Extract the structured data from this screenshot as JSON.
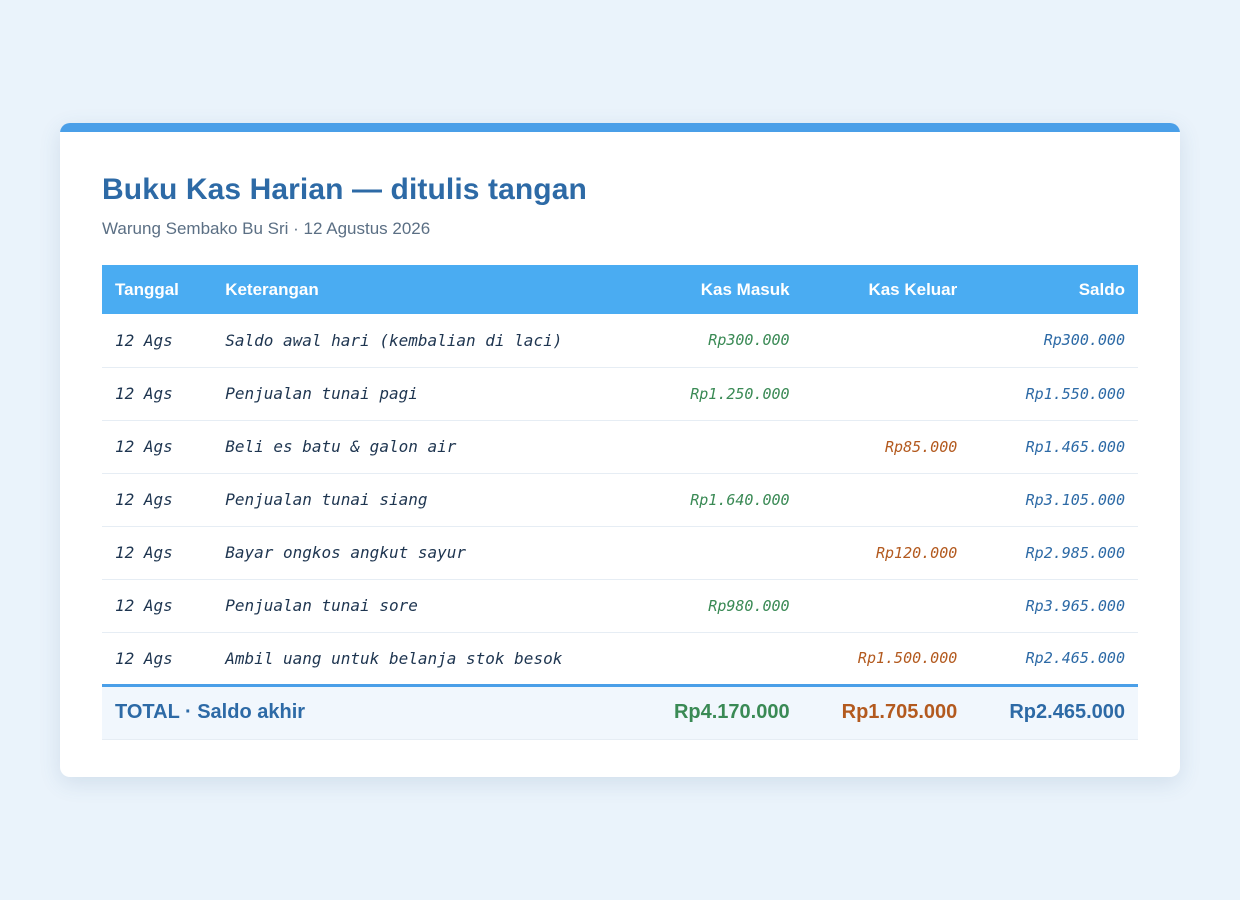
{
  "header": {
    "title": "Buku Kas Harian — ditulis tangan",
    "subtitle": "Warung Sembako Bu Sri · 12 Agustus 2026"
  },
  "table": {
    "columns": [
      "Tanggal",
      "Keterangan",
      "Kas Masuk",
      "Kas Keluar",
      "Saldo"
    ],
    "rows": [
      {
        "date": "12 Ags",
        "desc": "Saldo awal hari (kembalian di laci)",
        "in": "Rp300.000",
        "out": "",
        "balance": "Rp300.000"
      },
      {
        "date": "12 Ags",
        "desc": "Penjualan tunai pagi",
        "in": "Rp1.250.000",
        "out": "",
        "balance": "Rp1.550.000"
      },
      {
        "date": "12 Ags",
        "desc": "Beli es batu & galon air",
        "in": "",
        "out": "Rp85.000",
        "balance": "Rp1.465.000"
      },
      {
        "date": "12 Ags",
        "desc": "Penjualan tunai siang",
        "in": "Rp1.640.000",
        "out": "",
        "balance": "Rp3.105.000"
      },
      {
        "date": "12 Ags",
        "desc": "Bayar ongkos angkut sayur",
        "in": "",
        "out": "Rp120.000",
        "balance": "Rp2.985.000"
      },
      {
        "date": "12 Ags",
        "desc": "Penjualan tunai sore",
        "in": "Rp980.000",
        "out": "",
        "balance": "Rp3.965.000"
      },
      {
        "date": "12 Ags",
        "desc": "Ambil uang untuk belanja stok besok",
        "in": "",
        "out": "Rp1.500.000",
        "balance": "Rp2.465.000"
      }
    ],
    "total": {
      "label": "TOTAL · Saldo akhir",
      "in": "Rp4.170.000",
      "out": "Rp1.705.000",
      "balance": "Rp2.465.000"
    }
  },
  "colors": {
    "accent": "#4a9fe8",
    "header_bg": "#4aacf2",
    "title": "#2d6aa6",
    "cash_in": "#3a8a55",
    "cash_out": "#b35a1f",
    "balance": "#2d6aa6"
  }
}
